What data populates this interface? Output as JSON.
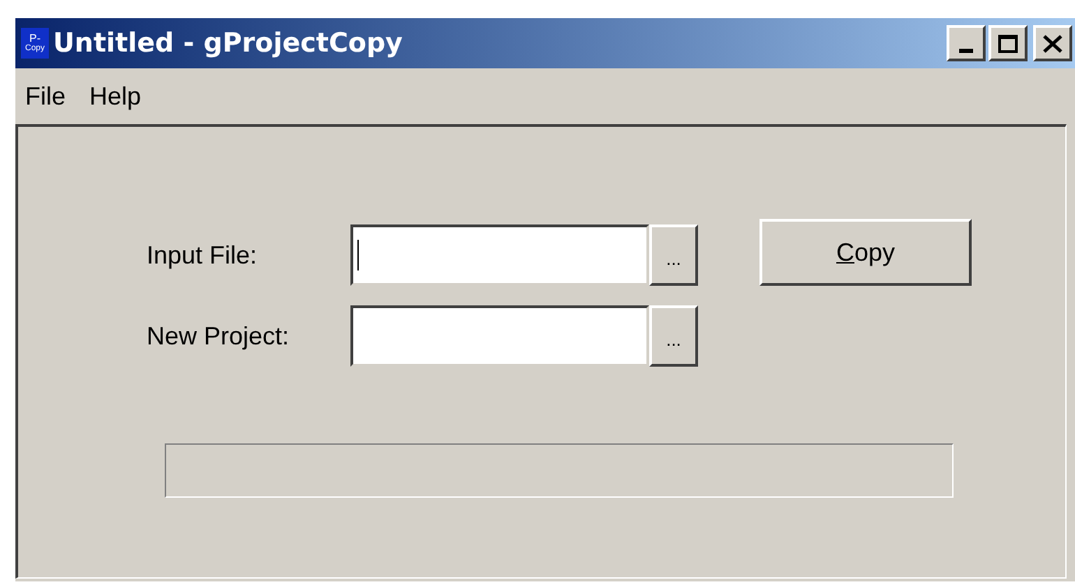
{
  "window": {
    "title": "Untitled - gProjectCopy",
    "app_icon": {
      "line_1": "P-",
      "line_2": "Copy"
    }
  },
  "menu": [
    "File",
    "Help"
  ],
  "fields": [
    {
      "label": "Input File:",
      "focused": true,
      "browse_button": "..."
    },
    {
      "label": "New Project:",
      "focused": false,
      "browse_button": "..."
    }
  ],
  "copy_button": {
    "label": "Copy",
    "first_letter_underlined": true
  },
  "progress": {
    "level": 0
  }
}
